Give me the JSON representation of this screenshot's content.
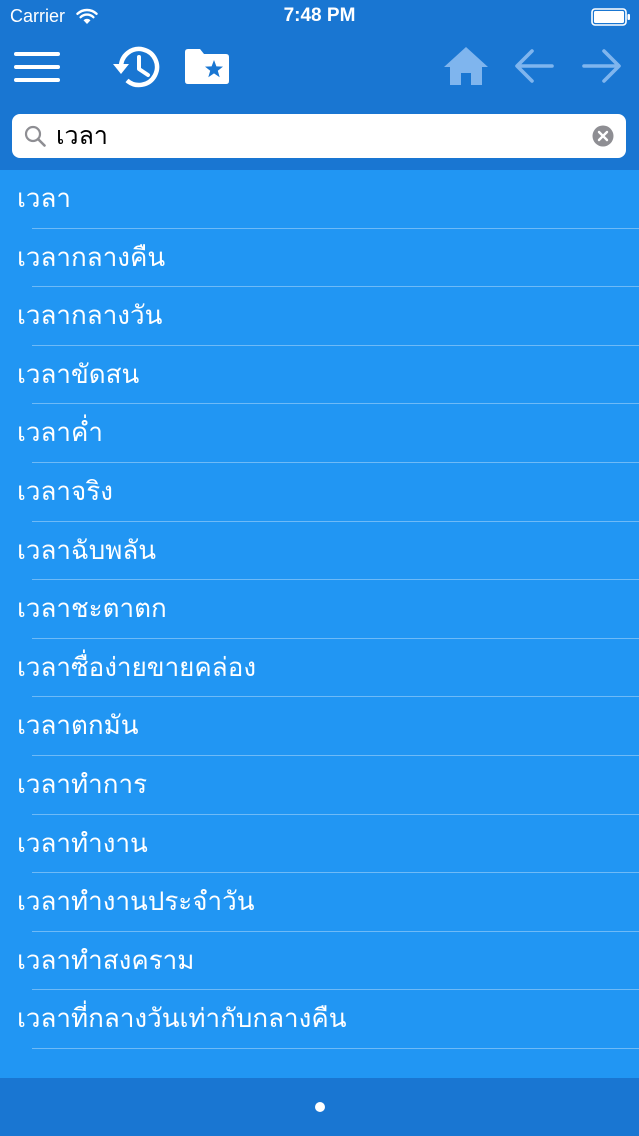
{
  "status": {
    "carrier": "Carrier",
    "time": "7:48 PM",
    "wifi_icon": "wifi-icon",
    "battery_icon": "battery-icon"
  },
  "toolbar": {
    "menu_icon": "hamburger-menu-icon",
    "history_icon": "history-icon",
    "favorites_icon": "favorites-folder-icon",
    "home_icon": "home-icon",
    "back_icon": "arrow-left-icon",
    "forward_icon": "arrow-right-icon"
  },
  "search": {
    "value": "เวลา",
    "search_icon": "search-icon",
    "clear_icon": "clear-icon"
  },
  "results": [
    "เวลา",
    "เวลากลางคืน",
    "เวลากลางวัน",
    "เวลาขัดสน",
    "เวลาค่ำ",
    "เวลาจริง",
    "เวลาฉับพลัน",
    "เวลาชะตาตก",
    "เวลาซื่อง่ายขายคล่อง",
    "เวลาตกมัน",
    "เวลาทำการ",
    "เวลาทำงาน",
    "เวลาทำงานประจำวัน",
    "เวลาทำสงคราม",
    "เวลาที่กลางวันเท่ากับกลางคืน"
  ],
  "colors": {
    "bar": "#1976d2",
    "list_background": "#2196f3",
    "icon_active": "#ffffff",
    "icon_inactive": "#7fb5ee"
  },
  "pager": {
    "pages": 1,
    "current": 1
  }
}
